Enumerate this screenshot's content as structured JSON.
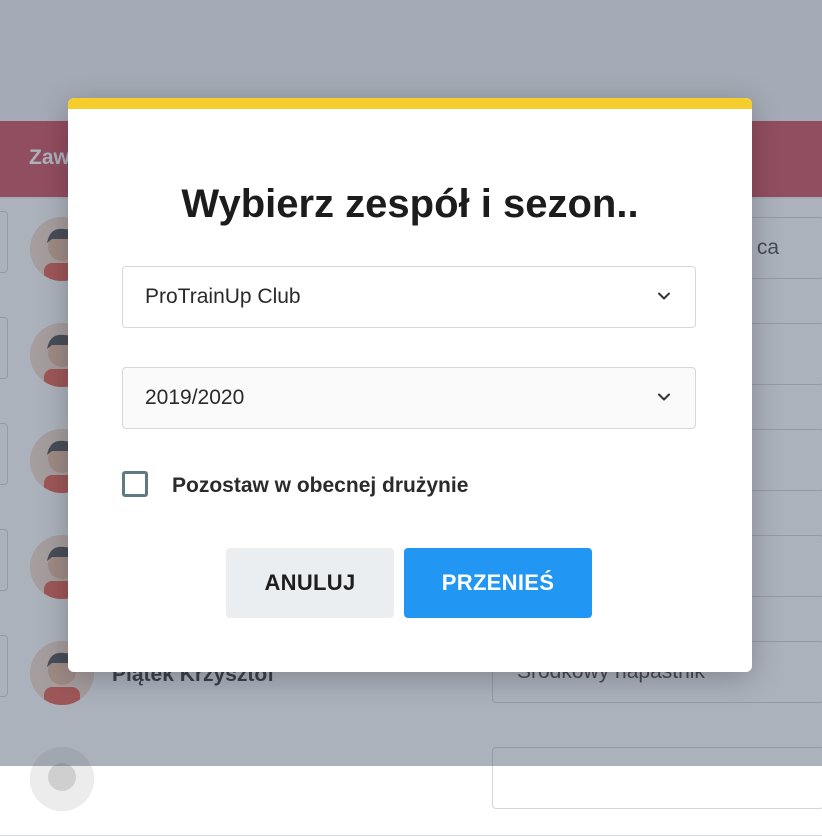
{
  "background": {
    "table_header_label": "Zaw",
    "rows": [
      {
        "name": "",
        "position": "ca"
      },
      {
        "name": "",
        "position": ""
      },
      {
        "name": "",
        "position": ""
      },
      {
        "name": "",
        "position": ""
      },
      {
        "name": "Piątek Krzysztof",
        "position": "Środkowy napastnik"
      }
    ]
  },
  "modal": {
    "title": "Wybierz zespół i sezon..",
    "team_select": {
      "value": "ProTrainUp Club"
    },
    "season_select": {
      "value": "2019/2020"
    },
    "checkbox": {
      "label": "Pozostaw w obecnej drużynie",
      "checked": false
    },
    "cancel_label": "ANULUJ",
    "move_label": "PRZENIEŚ"
  },
  "colors": {
    "accent_top_bar": "#f5cd2c",
    "primary_button": "#2196f3",
    "header_bar": "#cf4a5a"
  },
  "icons": {
    "select_arrow": "chevron-down-icon",
    "avatar": "user-avatar-icon"
  }
}
